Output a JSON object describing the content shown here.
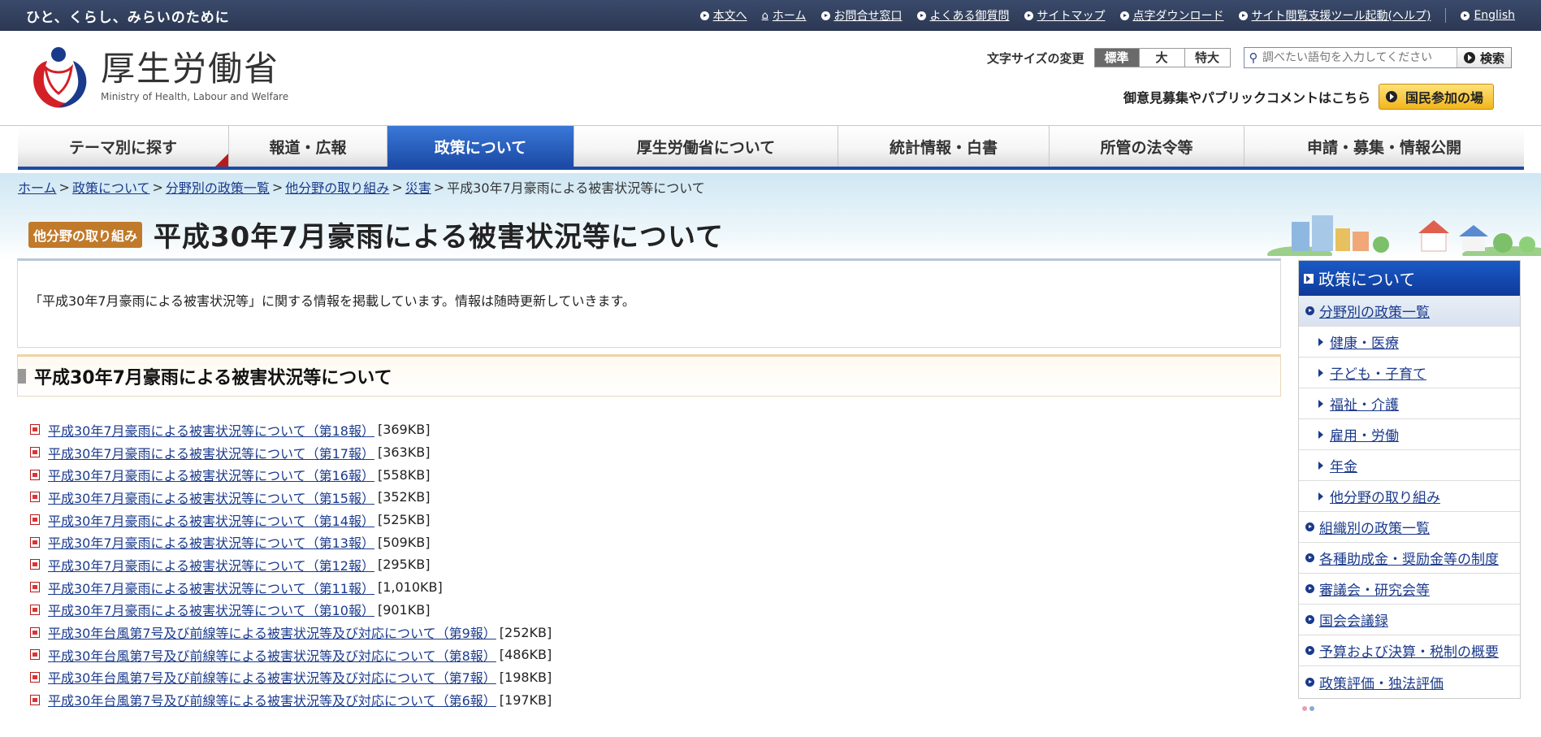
{
  "utility": {
    "tagline": "ひと、くらし、みらいのために",
    "links": [
      "本文へ",
      "ホーム",
      "お問合せ窓口",
      "よくある御質問",
      "サイトマップ",
      "点字ダウンロード",
      "サイト閲覧支援ツール起動(ヘルプ)",
      "English"
    ]
  },
  "logo": {
    "jp": "厚生労働省",
    "en": "Ministry of Health, Labour and Welfare"
  },
  "font_size": {
    "label": "文字サイズの変更",
    "options": [
      "標準",
      "大",
      "特大"
    ],
    "selected": "標準"
  },
  "search": {
    "placeholder": "調べたい語句を入力してください",
    "button": "検索"
  },
  "public_comment": {
    "text": "御意見募集やパブリックコメントはこちら",
    "button": "国民参加の場"
  },
  "nav": {
    "items": [
      "テーマ別に探す",
      "報道・広報",
      "政策について",
      "厚生労働省について",
      "統計情報・白書",
      "所管の法令等",
      "申請・募集・情報公開"
    ],
    "active": "政策について"
  },
  "breadcrumb": {
    "items": [
      "ホーム",
      "政策について",
      "分野別の政策一覧",
      "他分野の取り組み",
      "災害"
    ],
    "current": "平成30年7月豪雨による被害状況等について"
  },
  "page": {
    "tag": "他分野の取り組み",
    "title": "平成30年7月豪雨による被害状況等について",
    "lead": "「平成30年7月豪雨による被害状況等」に関する情報を掲載しています。情報は随時更新していきます。",
    "section_title": "平成30年7月豪雨による被害状況等について"
  },
  "reports": [
    {
      "title": "平成30年7月豪雨による被害状況等について（第18報）",
      "size": "[369KB]"
    },
    {
      "title": "平成30年7月豪雨による被害状況等について（第17報）",
      "size": "[363KB]"
    },
    {
      "title": "平成30年7月豪雨による被害状況等について（第16報）",
      "size": "[558KB]"
    },
    {
      "title": "平成30年7月豪雨による被害状況等について（第15報）",
      "size": "[352KB]"
    },
    {
      "title": "平成30年7月豪雨による被害状況等について（第14報）",
      "size": "[525KB]"
    },
    {
      "title": "平成30年7月豪雨による被害状況等について（第13報）",
      "size": "[509KB]"
    },
    {
      "title": "平成30年7月豪雨による被害状況等について（第12報）",
      "size": "[295KB]"
    },
    {
      "title": "平成30年7月豪雨による被害状況等について（第11報）",
      "size": "[1,010KB]"
    },
    {
      "title": "平成30年7月豪雨による被害状況等について（第10報）",
      "size": "[901KB]"
    },
    {
      "title": "平成30年台風第7号及び前線等による被害状況等及び対応について（第9報）",
      "size": "[252KB]"
    },
    {
      "title": "平成30年台風第7号及び前線等による被害状況等及び対応について（第8報）",
      "size": "[486KB]"
    },
    {
      "title": "平成30年台風第7号及び前線等による被害状況等及び対応について（第7報）",
      "size": "[198KB]"
    },
    {
      "title": "平成30年台風第7号及び前線等による被害状況等及び対応について（第6報）",
      "size": "[197KB]"
    }
  ],
  "sidebar": {
    "heading": "政策について",
    "items": [
      {
        "label": "分野別の政策一覧",
        "level": 1
      },
      {
        "label": "健康・医療",
        "level": 2
      },
      {
        "label": "子ども・子育て",
        "level": 2
      },
      {
        "label": "福祉・介護",
        "level": 2
      },
      {
        "label": "雇用・労働",
        "level": 2
      },
      {
        "label": "年金",
        "level": 2
      },
      {
        "label": "他分野の取り組み",
        "level": 2
      },
      {
        "label": "組織別の政策一覧",
        "level": 1
      },
      {
        "label": "各種助成金・奨励金等の制度",
        "level": 1
      },
      {
        "label": "審議会・研究会等",
        "level": 1
      },
      {
        "label": "国会会議録",
        "level": 1
      },
      {
        "label": "予算および決算・税制の概要",
        "level": 1
      },
      {
        "label": "政策評価・独法評価",
        "level": 1
      }
    ]
  },
  "colors": {
    "utility_bg": "#2c3854",
    "nav_active": "#1c4aa6",
    "tag": "#c07a2a",
    "link": "#1a3a8c",
    "logo_red": "#d32027",
    "logo_blue": "#1a3a8c"
  }
}
